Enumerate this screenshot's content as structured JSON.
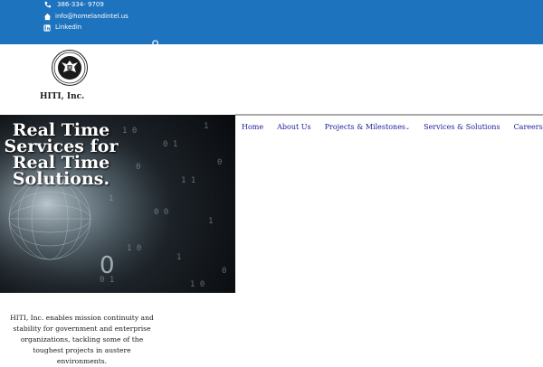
{
  "contact": {
    "phone": "386-334- 9709",
    "email": "info@homelandintel.us",
    "linkedin": "Linkedin"
  },
  "brand": {
    "name": "HITI, Inc."
  },
  "hero": {
    "title": "Real Time Services for Real Time Solutions."
  },
  "nav": [
    {
      "label": "Home"
    },
    {
      "label": "About Us"
    },
    {
      "label": "Projects & Milestones"
    },
    {
      "label": "Services & Solutions"
    },
    {
      "label": "Careers"
    }
  ],
  "about": {
    "text": "HITI, Inc. enables mission continuity and stability for government and enterprise organizations, tackling some of the toughest projects in austere environments."
  },
  "colors": {
    "topbar": "#1e73be",
    "nav_link": "#1a1a9a"
  }
}
